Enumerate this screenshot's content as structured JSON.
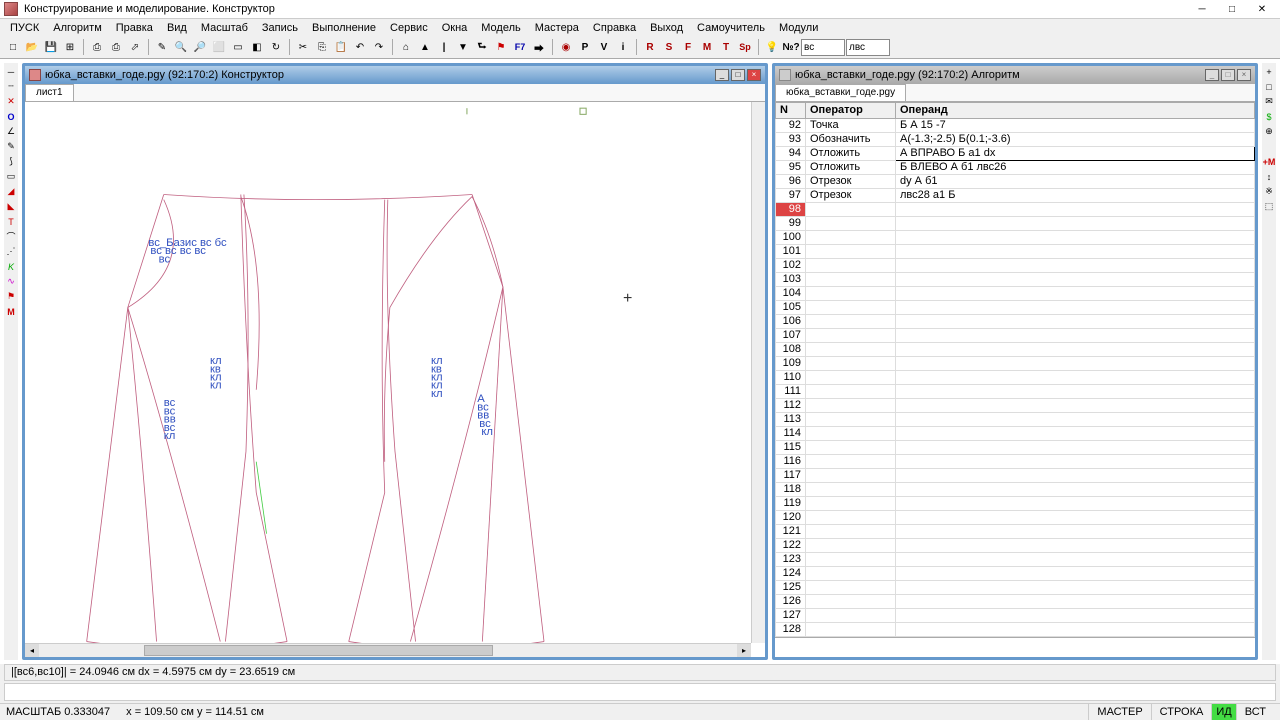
{
  "app": {
    "title": "Конструирование и моделирование. Конструктор"
  },
  "menu": [
    "ПУСК",
    "Алгоритм",
    "Правка",
    "Вид",
    "Масштаб",
    "Запись",
    "Выполнение",
    "Сервис",
    "Окна",
    "Модель",
    "Мастера",
    "Справка",
    "Выход",
    "Самоучитель",
    "Модули"
  ],
  "toolbar": {
    "input1": "вс",
    "input2": "лвс"
  },
  "left_panel": {
    "title": "юбка_вставки_годе.pgy (92:170:2) Конструктор",
    "tab": "лист1"
  },
  "right_panel": {
    "title": "юбка_вставки_годе.pgy (92:170:2) Алгоритм",
    "tab": "юбка_вставки_годе.pgy",
    "cols": {
      "n": "N",
      "op": "Оператор",
      "arg": "Операнд"
    },
    "rows": [
      {
        "n": "92",
        "op": "Точка",
        "arg": "Б А 15 -7"
      },
      {
        "n": "93",
        "op": "Обозначить",
        "arg": "А(-1.3;-2.5) Б(0.1;-3.6)"
      },
      {
        "n": "94",
        "op": "Отложить",
        "arg": "А ВПРАВО Б а1 dx",
        "sel": true
      },
      {
        "n": "95",
        "op": "Отложить",
        "arg": "Б ВЛЕВО А б1 лвс26"
      },
      {
        "n": "96",
        "op": "Отрезок",
        "arg": "dy А б1"
      },
      {
        "n": "97",
        "op": "Отрезок",
        "arg": "лвс28 а1 Б"
      },
      {
        "n": "98",
        "op": "",
        "arg": "",
        "hl": true
      },
      {
        "n": "99",
        "op": "",
        "arg": ""
      },
      {
        "n": "100",
        "op": "",
        "arg": ""
      },
      {
        "n": "101",
        "op": "",
        "arg": ""
      },
      {
        "n": "102",
        "op": "",
        "arg": ""
      },
      {
        "n": "103",
        "op": "",
        "arg": ""
      },
      {
        "n": "104",
        "op": "",
        "arg": ""
      },
      {
        "n": "105",
        "op": "",
        "arg": ""
      },
      {
        "n": "106",
        "op": "",
        "arg": ""
      },
      {
        "n": "107",
        "op": "",
        "arg": ""
      },
      {
        "n": "108",
        "op": "",
        "arg": ""
      },
      {
        "n": "109",
        "op": "",
        "arg": ""
      },
      {
        "n": "110",
        "op": "",
        "arg": ""
      },
      {
        "n": "111",
        "op": "",
        "arg": ""
      },
      {
        "n": "112",
        "op": "",
        "arg": ""
      },
      {
        "n": "113",
        "op": "",
        "arg": ""
      },
      {
        "n": "114",
        "op": "",
        "arg": ""
      },
      {
        "n": "115",
        "op": "",
        "arg": ""
      },
      {
        "n": "116",
        "op": "",
        "arg": ""
      },
      {
        "n": "117",
        "op": "",
        "arg": ""
      },
      {
        "n": "118",
        "op": "",
        "arg": ""
      },
      {
        "n": "119",
        "op": "",
        "arg": ""
      },
      {
        "n": "120",
        "op": "",
        "arg": ""
      },
      {
        "n": "121",
        "op": "",
        "arg": ""
      },
      {
        "n": "122",
        "op": "",
        "arg": ""
      },
      {
        "n": "123",
        "op": "",
        "arg": ""
      },
      {
        "n": "124",
        "op": "",
        "arg": ""
      },
      {
        "n": "125",
        "op": "",
        "arg": ""
      },
      {
        "n": "126",
        "op": "",
        "arg": ""
      },
      {
        "n": "127",
        "op": "",
        "arg": ""
      },
      {
        "n": "128",
        "op": "",
        "arg": ""
      }
    ]
  },
  "status1": "|[вс6,вс10]| = 24.0946 см   dx = 4.5975 см   dy = 23.6519 см",
  "status2": {
    "scale": "МАСШТАБ 0.333047",
    "coords": "x = 109.50 см   y = 114.51 см",
    "master": "МАСТЕР",
    "stroka": "СТРОКА",
    "vl": "ИД",
    "vst": "ВСТ"
  }
}
